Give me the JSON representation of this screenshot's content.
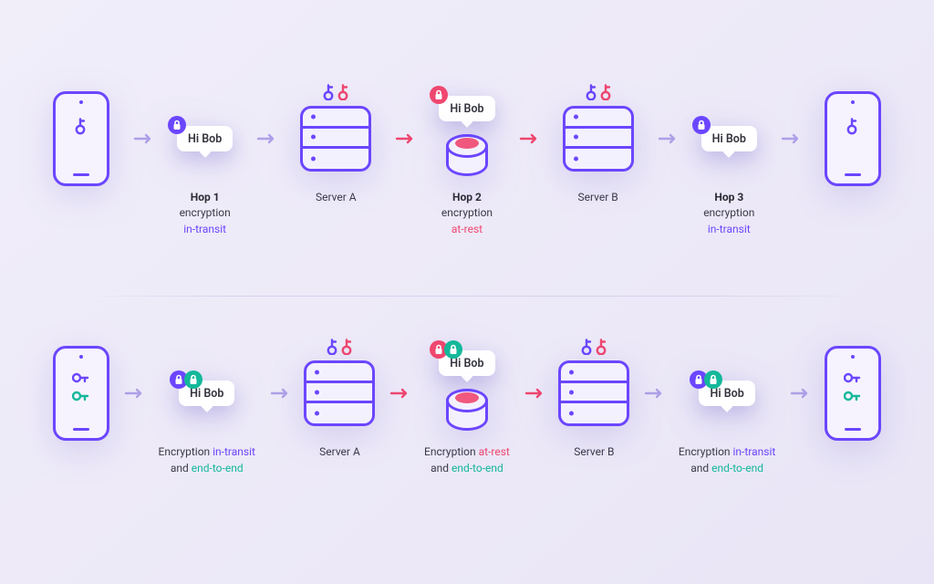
{
  "message": "Hi Bob",
  "colors": {
    "purple": "#6b46ff",
    "pink": "#ef476f",
    "teal": "#14b89a"
  },
  "row_top": {
    "hop1": {
      "title": "Hop 1",
      "subtitle": "encryption",
      "mode": "in-transit"
    },
    "serverA": "Server A",
    "hop2": {
      "title": "Hop 2",
      "subtitle": "encryption",
      "mode": "at-rest"
    },
    "serverB": "Server B",
    "hop3": {
      "title": "Hop 3",
      "subtitle": "encryption",
      "mode": "in-transit"
    }
  },
  "row_bottom": {
    "hop1": {
      "line1_prefix": "Encryption ",
      "line1_mode": "in-transit",
      "line2_prefix": "and ",
      "line2_mode": "end-to-end"
    },
    "serverA": "Server A",
    "hop2": {
      "line1_prefix": "Encryption ",
      "line1_mode": "at-rest",
      "line2_prefix": "and ",
      "line2_mode": "end-to-end"
    },
    "serverB": "Server B",
    "hop3": {
      "line1_prefix": "Encryption ",
      "line1_mode": "in-transit",
      "line2_prefix": "and ",
      "line2_mode": "end-to-end"
    }
  }
}
